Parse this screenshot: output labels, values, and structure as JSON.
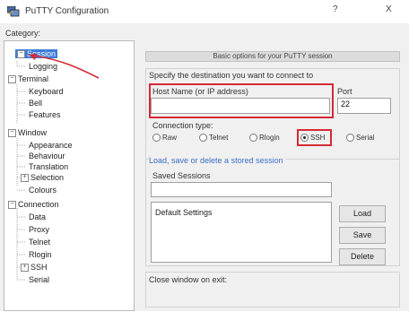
{
  "window": {
    "title": "PuTTY Configuration",
    "help_glyph": "?",
    "close_glyph": "X"
  },
  "category_label": "Category:",
  "tree": {
    "items": [
      {
        "label": "Session",
        "selected": true
      },
      {
        "label": "Logging"
      },
      {
        "label": "Terminal"
      },
      {
        "label": "Keyboard"
      },
      {
        "label": "Bell"
      },
      {
        "label": "Features"
      },
      {
        "label": "Window"
      },
      {
        "label": "Appearance"
      },
      {
        "label": "Behaviour"
      },
      {
        "label": "Translation"
      },
      {
        "label": "Selection"
      },
      {
        "label": "Colours"
      },
      {
        "label": "Connection"
      },
      {
        "label": "Data"
      },
      {
        "label": "Proxy"
      },
      {
        "label": "Telnet"
      },
      {
        "label": "Rlogin"
      },
      {
        "label": "SSH"
      },
      {
        "label": "Serial"
      }
    ]
  },
  "session": {
    "header": "Basic options for your PuTTY session",
    "destination_label": "Specify the destination you want to connect to",
    "host_label": "Host Name (or IP address)",
    "host_value": "",
    "port_label": "Port",
    "port_value": "22",
    "conn_type_label": "Connection type:",
    "conn_types": [
      {
        "label": "Raw",
        "selected": false
      },
      {
        "label": "Telnet",
        "selected": false
      },
      {
        "label": "Rlogin",
        "selected": false
      },
      {
        "label": "SSH",
        "selected": true
      },
      {
        "label": "Serial",
        "selected": false
      }
    ],
    "load_save_label": "Load, save or delete a stored session",
    "saved_sessions_label": "Saved Sessions",
    "saved_sessions_value": "",
    "sessions": [
      "Default Settings"
    ],
    "buttons": {
      "load": "Load",
      "save": "Save",
      "delete": "Delete"
    },
    "close_window_label": "Close window on exit:"
  },
  "colors": {
    "highlight": "#d42a36",
    "selection": "#3b7dd8"
  }
}
